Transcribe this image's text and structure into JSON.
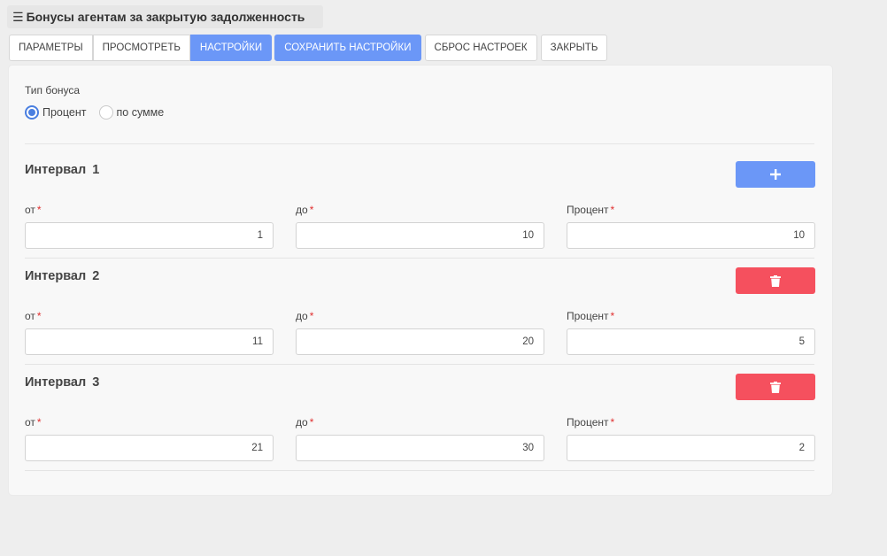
{
  "window": {
    "title": "Бонусы агентам за закрытую задолженность",
    "menu_icon": "hamburger-icon"
  },
  "tabs": [
    "ПАРАМЕТРЫ",
    "ПРОСМОТРЕТЬ",
    "НАСТРОЙКИ",
    "СОХРАНИТЬ НАСТРОЙКИ",
    "СБРОС НАСТРОЕК",
    "ЗАКРЫТЬ"
  ],
  "colors": {
    "accent": "#6b97f7",
    "danger": "#f5505e",
    "radio_checked": "#4a7fe0",
    "required": "#e03030"
  },
  "bonus_type": {
    "label": "Тип бонуса",
    "options": [
      {
        "label": "Процент",
        "checked": true
      },
      {
        "label": "по сумме",
        "checked": false
      }
    ]
  },
  "fields": {
    "from_label": "от",
    "to_label": "до",
    "percent_label": "Процент",
    "required_mark": "*"
  },
  "intervals": [
    {
      "title": "Интервал 1",
      "action": "add",
      "action_icon": "plus-icon",
      "from": "1",
      "to": "10",
      "percent": "10"
    },
    {
      "title": "Интервал 2",
      "action": "delete",
      "action_icon": "trash-icon",
      "from": "11",
      "to": "20",
      "percent": "5"
    },
    {
      "title": "Интервал 3",
      "action": "delete",
      "action_icon": "trash-icon",
      "from": "21",
      "to": "30",
      "percent": "2"
    }
  ]
}
